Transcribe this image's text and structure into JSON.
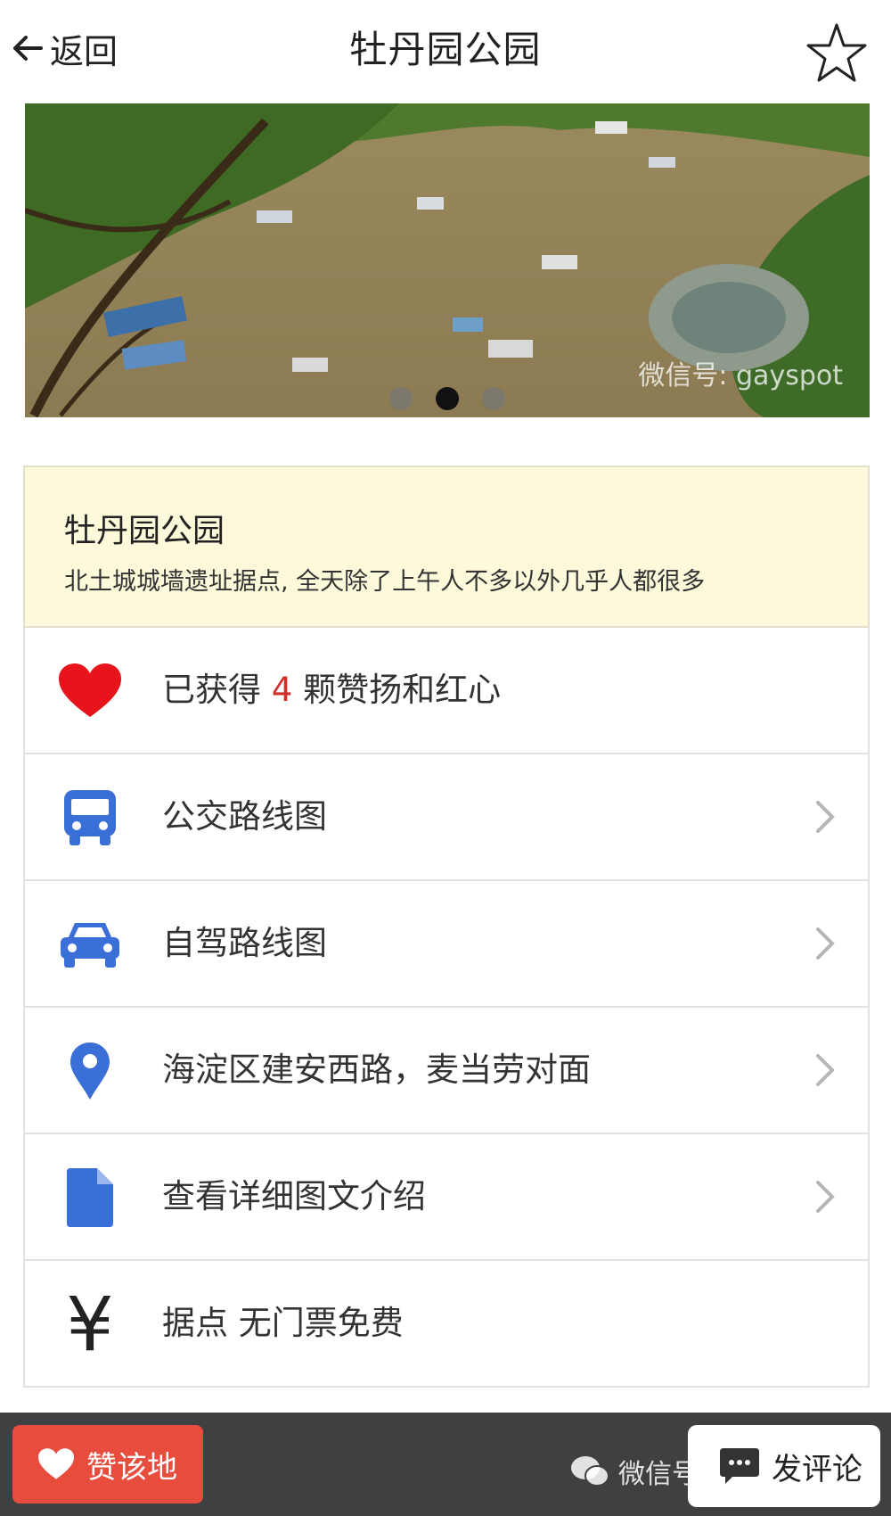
{
  "header": {
    "back_label": "返回",
    "title": "牡丹园公园"
  },
  "carousel": {
    "watermark": "微信号: gayspot",
    "dot_count": 3,
    "active_index": 1
  },
  "info": {
    "name": "牡丹园公园",
    "description": "北土城城墙遗址据点, 全天除了上午人不多以外几乎人都很多"
  },
  "rows": {
    "likes": {
      "prefix": "已获得 ",
      "count": "4",
      "suffix": " 颗赞扬和红心",
      "icon": "heart-icon"
    },
    "bus": {
      "label": "公交路线图",
      "icon": "bus-icon"
    },
    "drive": {
      "label": "自驾路线图",
      "icon": "car-icon"
    },
    "address": {
      "label": "海淀区建安西路，麦当劳对面",
      "icon": "location-pin-icon"
    },
    "details": {
      "label": "查看详细图文介绍",
      "icon": "document-icon"
    },
    "price": {
      "label": "据点 无门票免费",
      "icon": "yen-icon",
      "glyph": "¥"
    }
  },
  "bottom_bar": {
    "like_button": "赞该地",
    "comment_button": "发评论",
    "watermark": "微信号: bjtongzhi"
  },
  "colors": {
    "accent_blue": "#3b6fd8",
    "heart_red": "#e8141c",
    "like_button_bg": "#e74c3c",
    "info_bg": "#fdfadb",
    "bottom_bar_bg": "#3f4042"
  }
}
